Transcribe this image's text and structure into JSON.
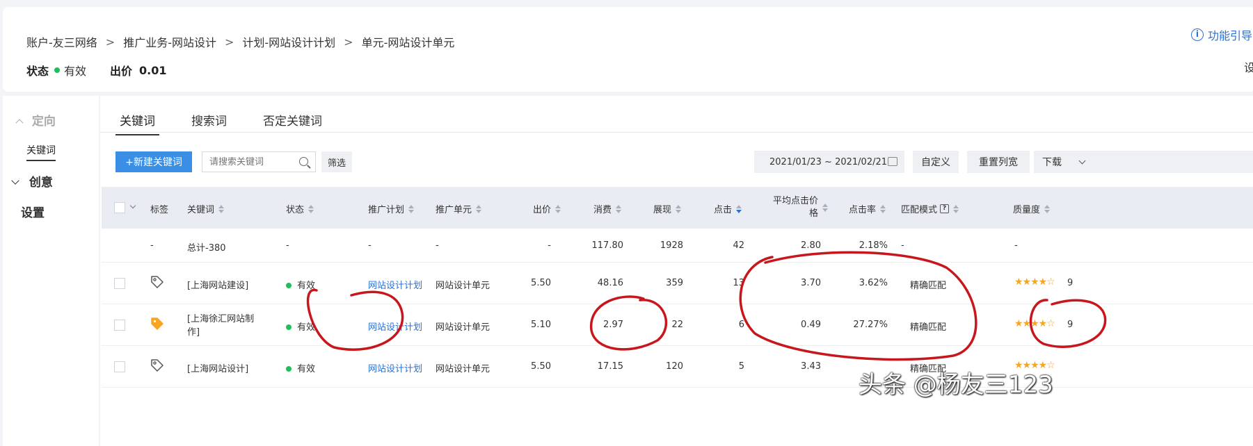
{
  "breadcrumb": [
    "账户-友三网络",
    "推广业务-网站设计",
    "计划-网站设计计划",
    "单元-网站设计单元"
  ],
  "breadcrumb_sep": ">",
  "status": {
    "label": "状态",
    "value": "有效",
    "bid_label": "出价",
    "bid_value": "0.01"
  },
  "guide_label": "功能引导",
  "settings_edge": "设",
  "sidebar": {
    "group1": "定向",
    "sub1": "关键词",
    "group2": "创意",
    "group3": "设置"
  },
  "tabs": [
    "关键词",
    "搜索词",
    "否定关键词"
  ],
  "toolbar": {
    "new_keyword": "+新建关键词",
    "search_placeholder": "请搜索关键词",
    "filter": "筛选",
    "date_range": "2021/01/23 ~ 2021/02/21",
    "custom": "自定义",
    "reset_width": "重置列宽",
    "download": "下载"
  },
  "columns": {
    "tag": "标签",
    "keyword": "关键词",
    "status": "状态",
    "plan": "推广计划",
    "unit": "推广单元",
    "bid": "出价",
    "cost": "消费",
    "impressions": "展现",
    "clicks": "点击",
    "avg_cpc_l1": "平均点击价",
    "avg_cpc_l2": "格",
    "ctr": "点击率",
    "match": "匹配模式",
    "quality": "质量度"
  },
  "total_row": {
    "tag": "-",
    "keyword": "总计-380",
    "status": "-",
    "plan": "-",
    "unit": "-",
    "bid": "-",
    "cost": "117.80",
    "impressions": "1928",
    "clicks": "42",
    "avg_cpc": "2.80",
    "ctr": "2.18%",
    "match": "-",
    "quality": "-"
  },
  "rows": [
    {
      "keyword": "[上海网站建设]",
      "status": "有效",
      "plan": "网站设计计划",
      "unit": "网站设计单元",
      "bid": "5.50",
      "cost": "48.16",
      "impressions": "359",
      "clicks": "13",
      "avg_cpc": "3.70",
      "ctr": "3.62%",
      "match": "精确匹配",
      "quality": "9",
      "quality_stars": "★★★★☆"
    },
    {
      "keyword_l1": "[上海徐汇网站制",
      "keyword_l2": "作]",
      "status": "有效",
      "plan": "网站设计计划",
      "unit": "网站设计单元",
      "bid": "5.10",
      "cost": "2.97",
      "impressions": "22",
      "clicks": "6",
      "avg_cpc": "0.49",
      "ctr": "27.27%",
      "match": "精确匹配",
      "quality": "9",
      "quality_stars": "★★★★☆"
    },
    {
      "keyword": "[上海网站设计]",
      "status": "有效",
      "plan": "网站设计计划",
      "unit": "网站设计单元",
      "bid": "5.50",
      "cost": "17.15",
      "impressions": "120",
      "clicks": "5",
      "avg_cpc": "3.43",
      "ctr": "",
      "match": "精确匹配",
      "quality": "",
      "quality_stars": "★★★★☆"
    }
  ],
  "watermark": "头条 @杨友三123",
  "colors": {
    "accent": "#3a8ee6",
    "link": "#2c6fd1",
    "status_green": "#1fc05b",
    "annotation_red": "#c8161d",
    "star": "#f5a623"
  }
}
